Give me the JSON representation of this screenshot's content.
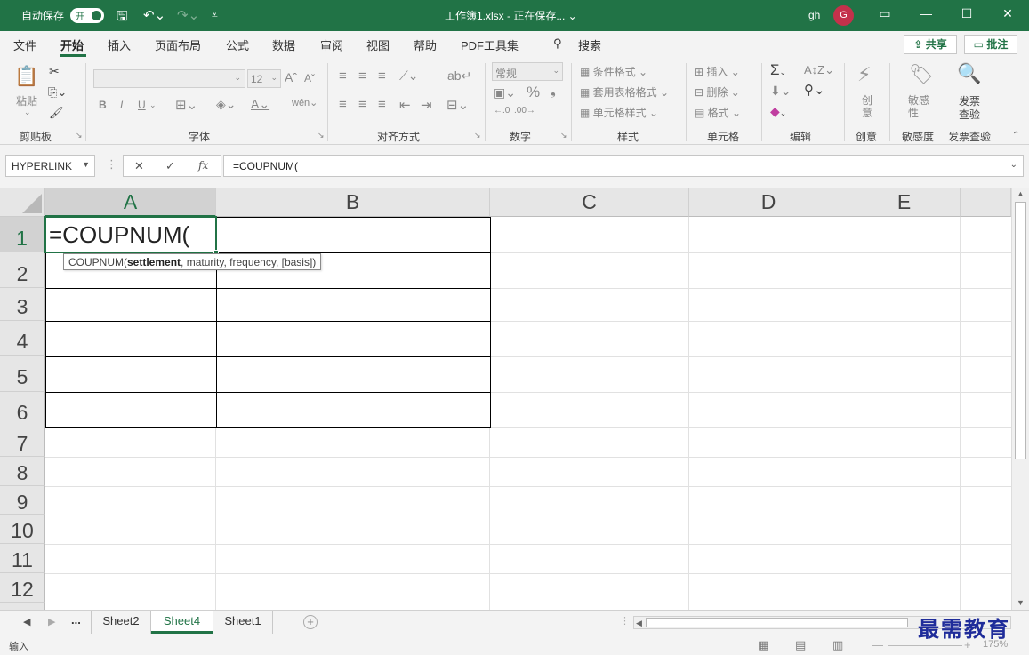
{
  "titlebar": {
    "autosave_label": "自动保存",
    "toggle_state": "开",
    "doc_title": "工作簿1.xlsx  -  正在保存...  ⌄",
    "user": "gh",
    "avatar_initial": "G"
  },
  "menu": {
    "tabs": [
      "文件",
      "开始",
      "插入",
      "页面布局",
      "公式",
      "数据",
      "审阅",
      "视图",
      "帮助",
      "PDF工具集"
    ],
    "search_label": "搜索",
    "share_label": "共享",
    "comment_label": "批注"
  },
  "ribbon": {
    "clipboard": {
      "paste": "粘贴",
      "group": "剪贴板"
    },
    "font": {
      "size": "12",
      "bold": "B",
      "italic": "I",
      "underline": "U",
      "group": "字体"
    },
    "alignment": {
      "group": "对齐方式"
    },
    "number": {
      "format": "常规",
      "group": "数字"
    },
    "styles": {
      "conditional": "条件格式",
      "table": "套用表格格式",
      "cell_styles": "单元格样式",
      "group": "样式"
    },
    "cells": {
      "insert": "插入",
      "delete": "删除",
      "format": "格式",
      "group": "单元格"
    },
    "editing": {
      "group": "编辑"
    },
    "ideas": {
      "label": "创\n意",
      "group": "创意"
    },
    "sensitivity": {
      "label": "敏感\n性",
      "group": "敏感度"
    },
    "invoice": {
      "label1": "发票",
      "label2": "查验",
      "group": "发票查验"
    }
  },
  "formula_bar": {
    "name_box": "HYPERLINK",
    "formula": "=COUPNUM("
  },
  "grid": {
    "columns": [
      "A",
      "B",
      "C",
      "D",
      "E"
    ],
    "rows": [
      "1",
      "2",
      "3",
      "4",
      "5",
      "6",
      "7",
      "8",
      "9",
      "10",
      "11",
      "12"
    ],
    "active_cell_text": "=COUPNUM(",
    "tooltip": {
      "fn": "COUPNUM(",
      "arg_bold": "settlement",
      "rest": ", maturity, frequency, [basis])"
    }
  },
  "sheets": {
    "ellipsis": "...",
    "tabs": [
      "Sheet2",
      "Sheet4",
      "Sheet1"
    ],
    "active": "Sheet4"
  },
  "status": {
    "mode": "输入",
    "zoom": "175%"
  },
  "watermark": "最需教育",
  "colors": {
    "accent": "#217346"
  }
}
